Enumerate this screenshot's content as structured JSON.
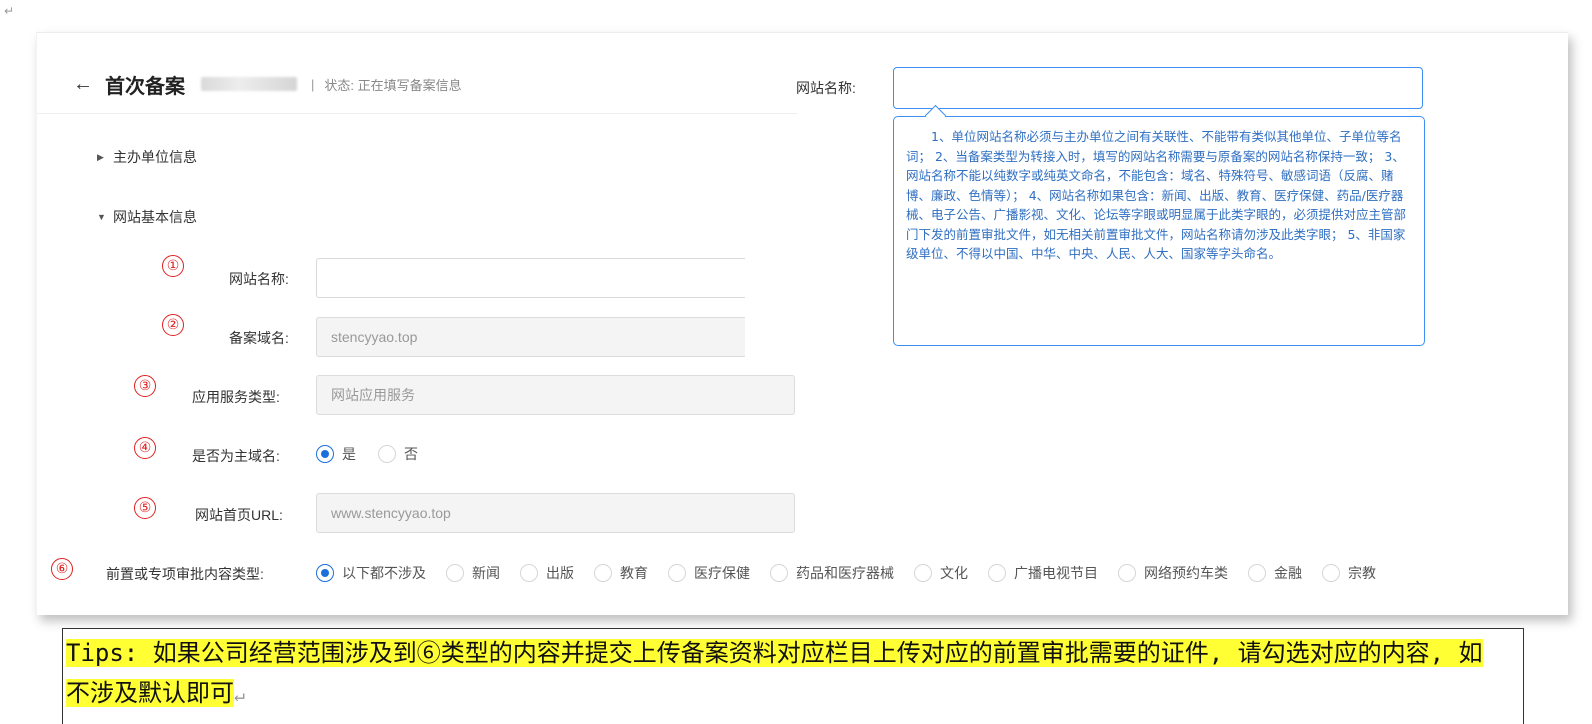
{
  "doc_mark": "↵",
  "header": {
    "back_icon": "←",
    "title": "首次备案",
    "separator": "|",
    "status": "状态: 正在填写备案信息"
  },
  "sections": [
    {
      "caret": "▶",
      "label": "主办单位信息",
      "expanded": false
    },
    {
      "caret": "▼",
      "label": "网站基本信息",
      "expanded": true
    }
  ],
  "fields": {
    "site_name": {
      "marker": "①",
      "label": "网站名称:",
      "value": ""
    },
    "domain": {
      "marker": "②",
      "label": "备案域名:",
      "value": "stencyyao.top"
    },
    "service_type": {
      "marker": "③",
      "label": "应用服务类型:",
      "value": "网站应用服务"
    },
    "main_domain": {
      "marker": "④",
      "label": "是否为主域名:",
      "options": [
        "是",
        "否"
      ],
      "selected": "是"
    },
    "homepage_url": {
      "marker": "⑤",
      "label": "网站首页URL:",
      "value": "www.stencyyao.top"
    },
    "approval_type": {
      "marker": "⑥",
      "label": "前置或专项审批内容类型:",
      "options": [
        "以下都不涉及",
        "新闻",
        "出版",
        "教育",
        "医疗保健",
        "药品和医疗器械",
        "文化",
        "广播电视节目",
        "网络预约车类",
        "金融",
        "宗教"
      ],
      "selected": "以下都不涉及"
    }
  },
  "popup": {
    "label": "网站名称:",
    "tooltip": "1、单位网站名称必须与主办单位之间有关联性、不能带有类似其他单位、子单位等名词； 2、当备案类型为转接入时，填写的网站名称需要与原备案的网站名称保持一致； 3、网站名称不能以纯数字或纯英文命名，不能包含：域名、特殊符号、敏感词语（反腐、赌博、廉政、色情等）； 4、网站名称如果包含：新闻、出版、教育、医疗保健、药品/医疗器械、电子公告、广播影视、文化、论坛等字眼或明显属于此类字眼的，必须提供对应主管部门下发的前置审批文件，如无相关前置审批文件，网站名称请勿涉及此类字眼； 5、非国家级单位、不得以中国、中华、中央、人民、人大、国家等字头命名。"
  },
  "tips": {
    "text": "Tips: 如果公司经营范围涉及到⑥类型的内容并提交上传备案资料对应栏目上传对应的前置审批需要的证件, 请勾选对应的内容, 如不涉及默认即可",
    "return_mark": "↵",
    "highlight_color": "#ffff33"
  },
  "colors": {
    "accent": "#1b6fdb",
    "marker": "#e02020",
    "tooltip_border": "#3b8ff5"
  }
}
